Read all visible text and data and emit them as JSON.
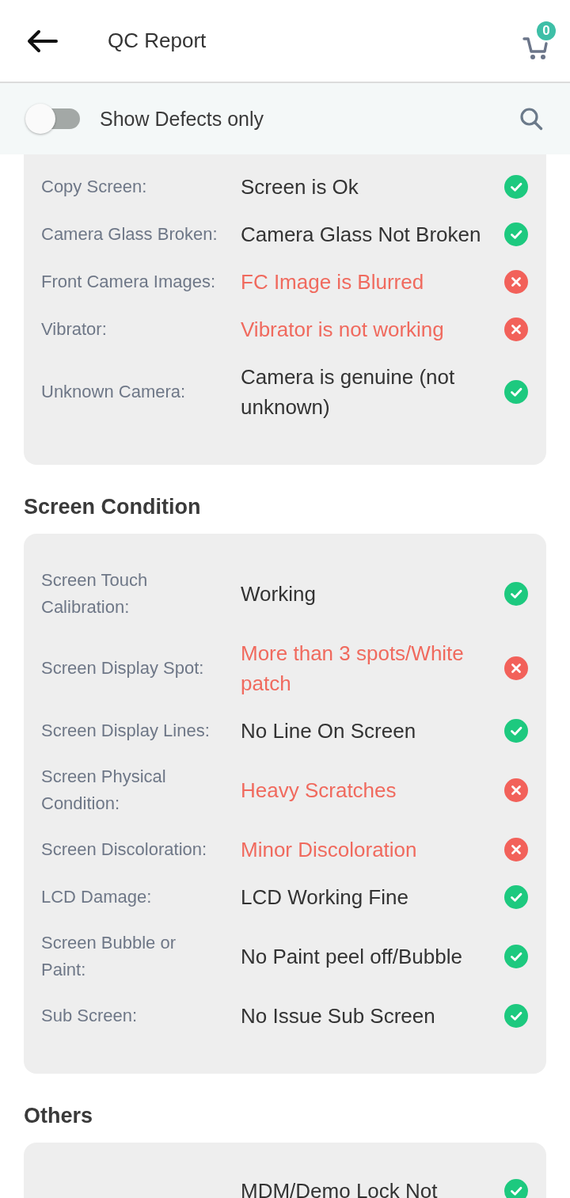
{
  "header": {
    "title": "QC Report",
    "cart_count": "0"
  },
  "filter": {
    "label": "Show Defects only",
    "on": false
  },
  "sections": [
    {
      "checks": [
        {
          "label": "Copy Screen:",
          "value": "Screen is Ok",
          "defect": false
        },
        {
          "label": "Camera Glass Broken:",
          "value": "Camera Glass Not Broken",
          "defect": false
        },
        {
          "label": "Front Camera Images:",
          "value": "FC Image is Blurred",
          "defect": true
        },
        {
          "label": "Vibrator:",
          "value": "Vibrator is not working",
          "defect": true
        },
        {
          "label": "Unknown Camera:",
          "value": "Camera is genuine (not unknown)",
          "defect": false
        }
      ]
    },
    {
      "title": "Screen Condition",
      "checks": [
        {
          "label": "Screen Touch Calibration:",
          "value": "Working",
          "defect": false
        },
        {
          "label": "Screen Display Spot:",
          "value": "More than 3 spots/White patch",
          "defect": true
        },
        {
          "label": "Screen Display Lines:",
          "value": "No Line On Screen",
          "defect": false
        },
        {
          "label": "Screen Physical Condition:",
          "value": "Heavy Scratches",
          "defect": true
        },
        {
          "label": "Screen Discoloration:",
          "value": "Minor Discoloration",
          "defect": true
        },
        {
          "label": "LCD Damage:",
          "value": "LCD Working Fine",
          "defect": false
        },
        {
          "label": "Screen Bubble or Paint:",
          "value": "No Paint peel off/Bubble",
          "defect": false
        },
        {
          "label": "Sub Screen:",
          "value": "No Issue Sub Screen",
          "defect": false
        }
      ]
    },
    {
      "title": "Others",
      "checks": [
        {
          "value": "MDM/Demo Lock Not",
          "defect": false
        }
      ]
    }
  ]
}
